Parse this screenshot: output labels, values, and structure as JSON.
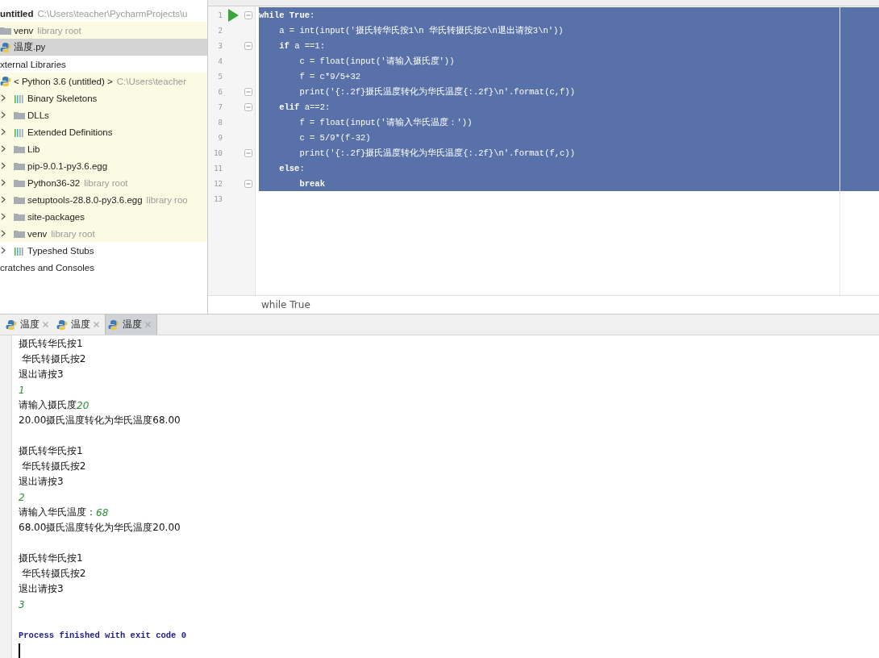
{
  "project_tree": [
    {
      "label": "untitled",
      "hint": "C:\\Users\\teacher\\PycharmProjects\\u",
      "kind": "project",
      "selected": false,
      "highlighted": false,
      "children": [
        {
          "label": "venv",
          "hint": "library root",
          "kind": "folder",
          "selected": false,
          "highlighted": true
        },
        {
          "label": "温度.py",
          "kind": "python-file",
          "selected": true,
          "highlighted": false
        }
      ]
    },
    {
      "label": "xternal Libraries",
      "kind": "group",
      "selected": false,
      "highlighted": false,
      "children": [
        {
          "label": "< Python 3.6 (untitled) >",
          "hint": "C:\\Users\\teacher",
          "kind": "python-sdk",
          "selected": false,
          "highlighted": true,
          "children": [
            {
              "label": "Binary Skeletons",
              "kind": "library",
              "expanded": false,
              "selected": false,
              "highlighted": true
            },
            {
              "label": "DLLs",
              "kind": "folder",
              "expanded": false,
              "selected": false,
              "highlighted": true
            },
            {
              "label": "Extended Definitions",
              "kind": "library",
              "expanded": false,
              "selected": false,
              "highlighted": true
            },
            {
              "label": "Lib",
              "kind": "folder",
              "expanded": false,
              "selected": false,
              "highlighted": true
            },
            {
              "label": "pip-9.0.1-py3.6.egg",
              "kind": "folder",
              "expanded": false,
              "selected": false,
              "highlighted": true
            },
            {
              "label": "Python36-32",
              "hint": "library root",
              "kind": "folder",
              "expanded": false,
              "selected": false,
              "highlighted": true
            },
            {
              "label": "setuptools-28.8.0-py3.6.egg",
              "hint": "library roo",
              "kind": "folder",
              "expanded": false,
              "selected": false,
              "highlighted": true
            },
            {
              "label": "site-packages",
              "kind": "folder",
              "expanded": false,
              "selected": false,
              "highlighted": true
            },
            {
              "label": "venv",
              "hint": "library root",
              "kind": "folder",
              "expanded": false,
              "selected": false,
              "highlighted": true
            },
            {
              "label": "Typeshed Stubs",
              "kind": "library",
              "expanded": false,
              "selected": false,
              "highlighted": false
            }
          ]
        }
      ]
    },
    {
      "label": "cratches and Consoles",
      "kind": "group",
      "selected": false,
      "highlighted": false
    }
  ],
  "editor": {
    "lines": [
      {
        "number": "1",
        "code": "**while True**:",
        "selected": true,
        "run": true,
        "fold": true
      },
      {
        "number": "2",
        "code": "    a = int(input('摄氏转华氏按1\\n 华氏转摄氏按2\\n退出请按3\\n'))",
        "selected": true,
        "run": false,
        "fold": false
      },
      {
        "number": "3",
        "code": "    **if** a ==1:",
        "selected": true,
        "run": false,
        "fold": true
      },
      {
        "number": "4",
        "code": "        c = float(input('请输入摄氏度'))",
        "selected": true,
        "run": false,
        "fold": false
      },
      {
        "number": "5",
        "code": "        f = c*9/5+32",
        "selected": true,
        "run": false,
        "fold": false
      },
      {
        "number": "6",
        "code": "        print('{:.2f}摄氏温度转化为华氏温度{:.2f}\\n'.format(c,f))",
        "selected": true,
        "run": false,
        "fold": true
      },
      {
        "number": "7",
        "code": "    **elif** a==2:",
        "selected": true,
        "run": false,
        "fold": true
      },
      {
        "number": "8",
        "code": "        f = float(input('请输入华氏温度：'))",
        "selected": true,
        "run": false,
        "fold": false
      },
      {
        "number": "9",
        "code": "        c = 5/9*(f-32)",
        "selected": true,
        "run": false,
        "fold": false
      },
      {
        "number": "10",
        "code": "        print('{:.2f}摄氏温度转化为华氏温度{:.2f}\\n'.format(f,c))",
        "selected": true,
        "run": false,
        "fold": true
      },
      {
        "number": "11",
        "code": "    **else**:",
        "selected": true,
        "run": false,
        "fold": false
      },
      {
        "number": "12",
        "code": "        **break**",
        "selected": true,
        "run": false,
        "fold": true
      },
      {
        "number": "13",
        "selected": false,
        "run": false,
        "fold": false
      }
    ],
    "breadcrumb": "while True"
  },
  "console": {
    "tabs": [
      {
        "label": "温度",
        "selected": false
      },
      {
        "label": "温度",
        "selected": false
      },
      {
        "label": "温度",
        "selected": true
      }
    ],
    "lines": [
      {
        "kind": "output",
        "text": "摄氏转华氏按1"
      },
      {
        "kind": "output",
        "text": " 华氏转摄氏按2"
      },
      {
        "kind": "output",
        "text": "退出请按3"
      },
      {
        "kind": "output",
        "input": "1"
      },
      {
        "kind": "output",
        "text": "请输入摄氏度",
        "input": "20"
      },
      {
        "kind": "output",
        "text": "20.00摄氏温度转化为华氏温度68.00"
      },
      {
        "kind": "blank"
      },
      {
        "kind": "output",
        "text": "摄氏转华氏按1"
      },
      {
        "kind": "output",
        "text": " 华氏转摄氏按2"
      },
      {
        "kind": "output",
        "text": "退出请按3"
      },
      {
        "kind": "output",
        "input": "2"
      },
      {
        "kind": "output",
        "text": "请输入华氏温度：",
        "input": "68"
      },
      {
        "kind": "output",
        "text": "68.00摄氏温度转化为华氏温度20.00"
      },
      {
        "kind": "blank"
      },
      {
        "kind": "output",
        "text": "摄氏转华氏按1"
      },
      {
        "kind": "output",
        "text": " 华氏转摄氏按2"
      },
      {
        "kind": "output",
        "text": "退出请按3"
      },
      {
        "kind": "output",
        "input": "3"
      },
      {
        "kind": "blank"
      },
      {
        "kind": "system",
        "text": "Process finished with exit code 0"
      },
      {
        "kind": "cursor"
      }
    ]
  }
}
